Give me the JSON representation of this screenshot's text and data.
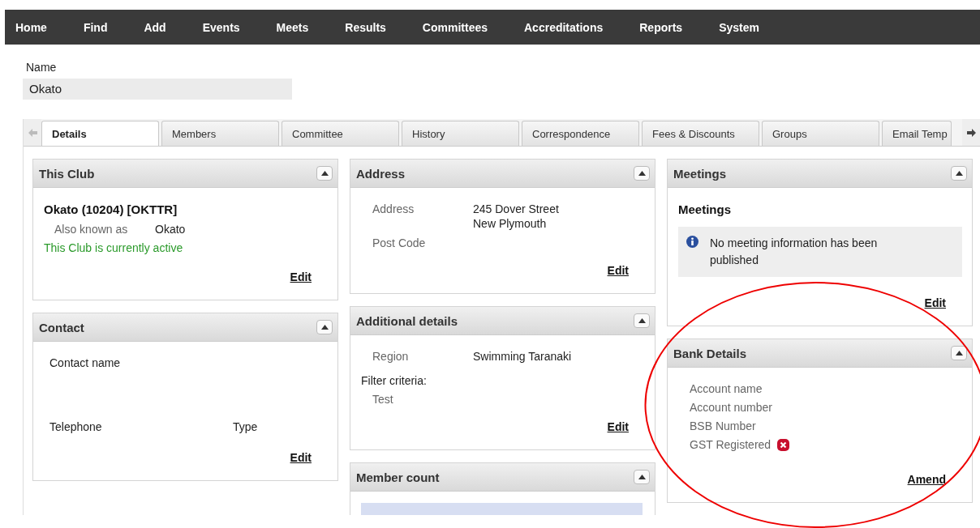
{
  "nav": [
    {
      "label": "Home"
    },
    {
      "label": "Find"
    },
    {
      "label": "Add"
    },
    {
      "label": "Events"
    },
    {
      "label": "Meets"
    },
    {
      "label": "Results"
    },
    {
      "label": "Committees"
    },
    {
      "label": "Accreditations"
    },
    {
      "label": "Reports"
    },
    {
      "label": "System"
    }
  ],
  "name_field": {
    "label": "Name",
    "value": "Okato"
  },
  "tabs": [
    {
      "label": "Details",
      "selected": true
    },
    {
      "label": "Members",
      "selected": false
    },
    {
      "label": "Committee",
      "selected": false
    },
    {
      "label": "History",
      "selected": false
    },
    {
      "label": "Correspondence",
      "selected": false
    },
    {
      "label": "Fees & Discounts",
      "selected": false
    },
    {
      "label": "Groups",
      "selected": false
    },
    {
      "label": "Email Temp",
      "selected": false
    }
  ],
  "this_club": {
    "title": "This Club",
    "expanded": true,
    "heading": "Okato (10204) [OKTTR]",
    "aka_label": "Also known as",
    "aka_value": "Okato",
    "status": "This Club is currently active",
    "action": "Edit"
  },
  "contact": {
    "title": "Contact",
    "expanded": true,
    "contact_label": "Contact name",
    "telephone_label": "Telephone",
    "type_label": "Type",
    "action": "Edit"
  },
  "address": {
    "title": "Address",
    "expanded": true,
    "address_label": "Address",
    "address_lines": [
      "245 Dover Street",
      "New Plymouth"
    ],
    "postcode_label": "Post Code",
    "action": "Edit"
  },
  "additional": {
    "title": "Additional details",
    "expanded": true,
    "region_label": "Region",
    "region_value": "Swimming Taranaki",
    "filter_label": "Filter criteria:",
    "filter_value": "Test",
    "action": "Edit"
  },
  "member_count": {
    "title": "Member count",
    "expanded": true
  },
  "meetings": {
    "title": "Meetings",
    "expanded": true,
    "heading": "Meetings",
    "message": "No meeting information has been published",
    "action": "Edit"
  },
  "bank": {
    "title": "Bank Details",
    "expanded": true,
    "fields": [
      {
        "label": "Account name"
      },
      {
        "label": "Account number"
      },
      {
        "label": "BSB Number"
      }
    ],
    "gst_label": "GST Registered",
    "gst_registered": false,
    "action": "Amend"
  }
}
